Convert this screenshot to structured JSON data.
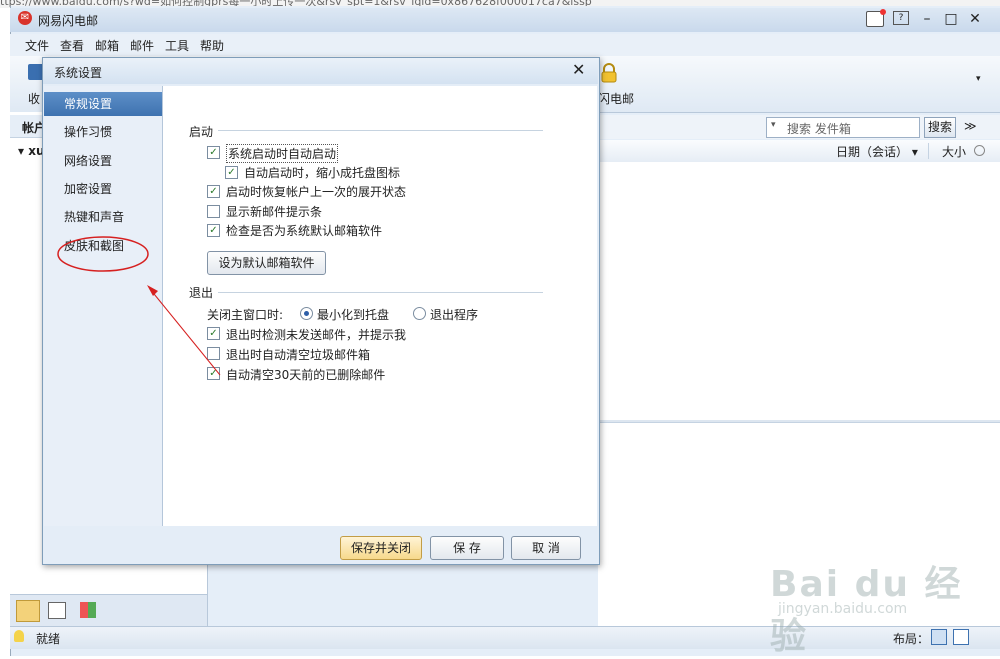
{
  "browser": {
    "url_fragment": "ttps://www.baidu.com/s?wd=如何控制gprs每一小时上传一次&rsv_spt=1&rsv_iqid=0x867628f000017ca7&issp"
  },
  "app": {
    "title": "网易闪电邮"
  },
  "menu": [
    "文件",
    "查看",
    "邮箱",
    "邮件",
    "工具",
    "帮助"
  ],
  "toolbar": {
    "receive_label": "收",
    "right_label": "闪电邮"
  },
  "left_pane": {
    "header": "帐户",
    "account": "xu"
  },
  "search": {
    "placeholder": "搜索 发件箱",
    "button": "搜索"
  },
  "columns": {
    "date": "日期（会话）",
    "size": "大小"
  },
  "status": {
    "text": "就绪",
    "layout_label": "布局："
  },
  "dialog": {
    "title": "系统设置",
    "nav": [
      "常规设置",
      "操作习惯",
      "网络设置",
      "加密设置",
      "热键和声音",
      "皮肤和截图"
    ],
    "selected_nav_index": 0,
    "startup": {
      "title": "启动",
      "options": [
        {
          "label": "系统启动时自动启动",
          "checked": true
        },
        {
          "label": "自动启动时，缩小成托盘图标",
          "checked": true
        },
        {
          "label": "启动时恢复帐户上一次的展开状态",
          "checked": true
        },
        {
          "label": "显示新邮件提示条",
          "checked": false
        },
        {
          "label": "检查是否为系统默认邮箱软件",
          "checked": true
        }
      ],
      "default_button": "设为默认邮箱软件"
    },
    "exit": {
      "title": "退出",
      "close_label": "关闭主窗口时:",
      "radio_minimize": "最小化到托盘",
      "radio_exit": "退出程序",
      "selected": "minimize",
      "options": [
        {
          "label": "退出时检测未发送邮件，并提示我",
          "checked": true
        },
        {
          "label": "退出时自动清空垃圾邮件箱",
          "checked": false
        },
        {
          "label": "自动清空30天前的已删除邮件",
          "checked": true
        }
      ]
    },
    "buttons": {
      "save_close": "保存并关闭",
      "save": "保 存",
      "cancel": "取 消"
    }
  },
  "watermark": {
    "brand": "Bai du 经验",
    "url": "jingyan.baidu.com"
  },
  "colors": {
    "annotation": "#d62020",
    "nav_selected": "#4a7dbb"
  }
}
